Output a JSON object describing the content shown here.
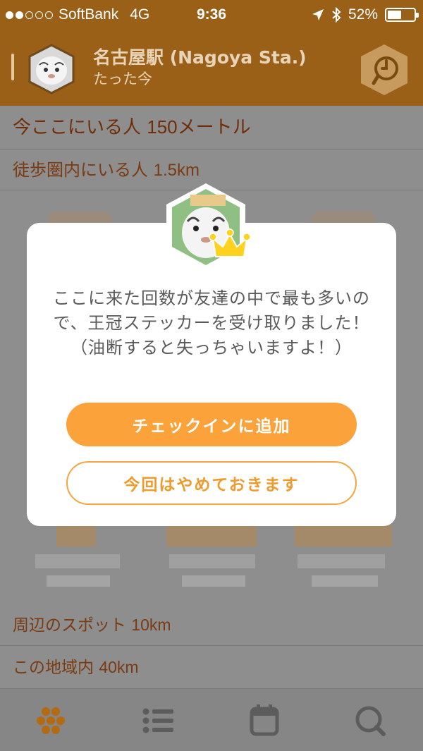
{
  "status_bar": {
    "carrier": "SoftBank",
    "network": "4G",
    "time": "9:36",
    "battery_text": "52%",
    "battery_level": 0.52,
    "signal_bars": 2,
    "icons": [
      "location-arrow-icon",
      "bluetooth-icon",
      "battery-icon"
    ]
  },
  "header": {
    "title": "名古屋駅 (Nagoya Sta.)",
    "subtitle": "たった今",
    "avatar_icon": "tiger-avatar",
    "action_icon": "spot-pin-icon"
  },
  "list": {
    "row1": {
      "label": "今ここにいる人 ",
      "value": "150メートル"
    },
    "row2": {
      "label": "徒歩圏内にいる人 ",
      "value": "1.5km"
    },
    "row3": {
      "label": "周辺のスポット ",
      "value": "10km"
    },
    "row4": {
      "label": "この地域内 ",
      "value": "40km"
    }
  },
  "dialog": {
    "message": "ここに来た回数が友達の中で最も多いので、王冠ステッカーを受け取りました！（油断すると失っちゃいますよ！）",
    "primary_label": "チェックインに追加",
    "secondary_label": "今回はやめておきます",
    "badge_icon": "crown-icon"
  },
  "tabbar": {
    "tabs": [
      "honeycomb-icon",
      "list-icon",
      "calendar-icon",
      "search-icon"
    ],
    "active_color": "#b36a10",
    "inactive_color": "#5c5c5c"
  },
  "colors": {
    "header": "#9a6018",
    "accent": "#fba33a",
    "overlay": "#8e8e8e"
  }
}
